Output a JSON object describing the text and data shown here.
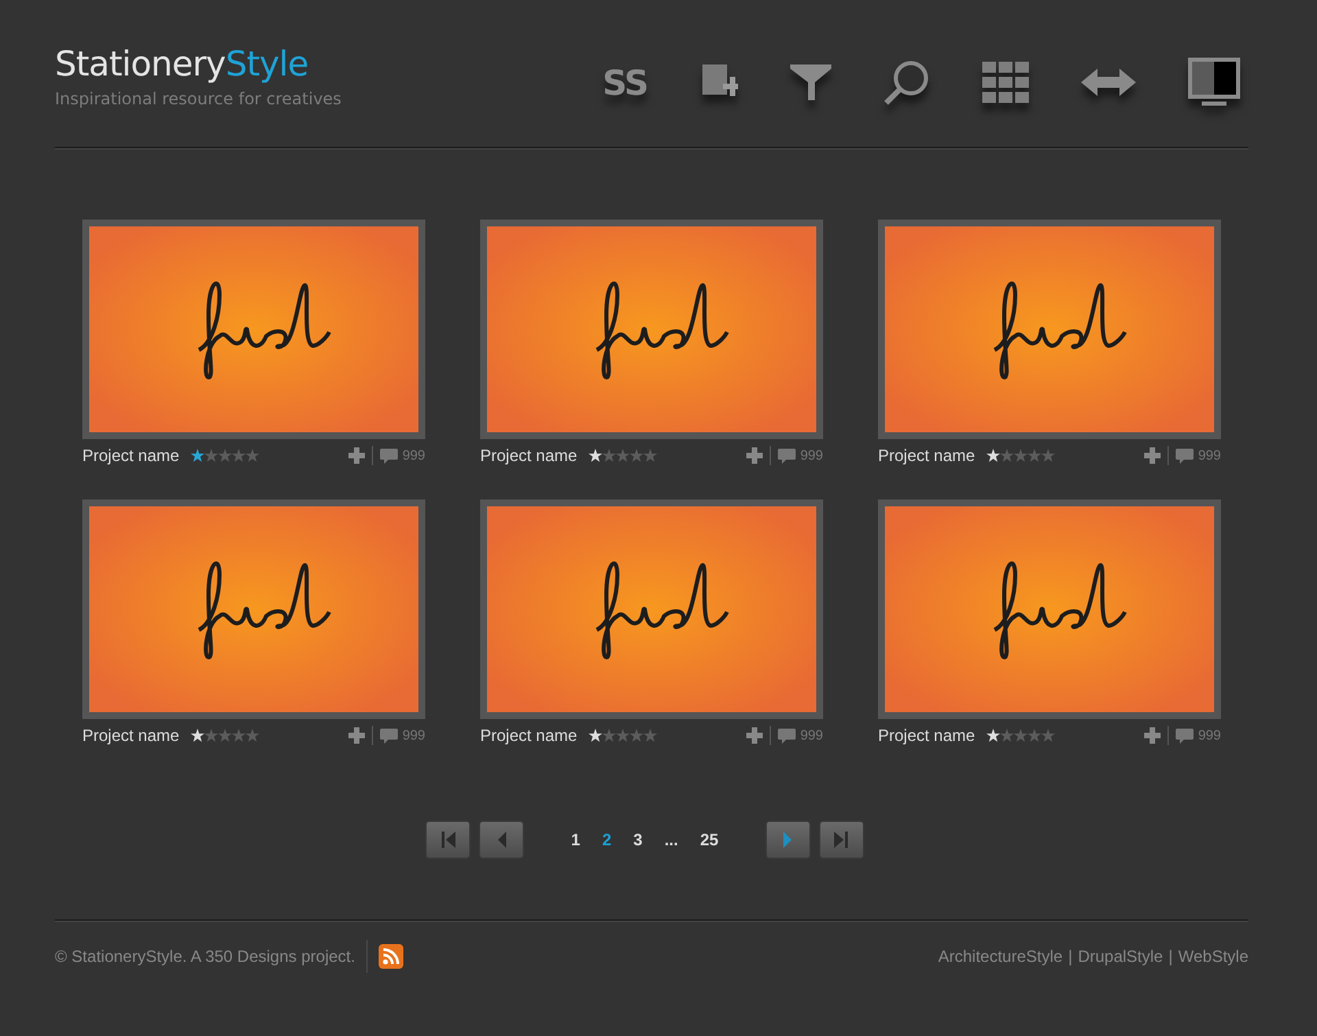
{
  "header": {
    "logo_main": "Stationery",
    "logo_accent": "Style",
    "tagline": "Inspirational resource for creatives",
    "toolbar": [
      {
        "kind": "text",
        "label": "SS"
      },
      {
        "kind": "add"
      },
      {
        "kind": "filter"
      },
      {
        "kind": "search"
      },
      {
        "kind": "grid"
      },
      {
        "kind": "resize"
      },
      {
        "kind": "monitor"
      }
    ]
  },
  "projects": [
    {
      "name": "Project name",
      "stars": 1,
      "highlighted": true,
      "comments": "999"
    },
    {
      "name": "Project name",
      "stars": 1,
      "highlighted": false,
      "comments": "999"
    },
    {
      "name": "Project name",
      "stars": 1,
      "highlighted": false,
      "comments": "999"
    },
    {
      "name": "Project name",
      "stars": 1,
      "highlighted": false,
      "comments": "999"
    },
    {
      "name": "Project name",
      "stars": 1,
      "highlighted": false,
      "comments": "999"
    },
    {
      "name": "Project name",
      "stars": 1,
      "highlighted": false,
      "comments": "999"
    }
  ],
  "pager": {
    "before": [
      {
        "kind": "first",
        "highlighted": false
      },
      {
        "kind": "prev",
        "highlighted": false
      }
    ],
    "pages": [
      {
        "label": "1",
        "selected": false
      },
      {
        "label": "2",
        "selected": true
      },
      {
        "label": "3",
        "selected": false
      },
      {
        "label": "...",
        "selected": false
      },
      {
        "label": "25",
        "selected": false
      }
    ],
    "after": [
      {
        "kind": "next",
        "highlighted": true
      },
      {
        "kind": "last",
        "highlighted": false
      }
    ]
  },
  "footer": {
    "copyright": "© StationeryStyle. A 350 Designs project.",
    "links": [
      "ArchitectureStyle",
      "DrupalStyle",
      "WebStyle"
    ],
    "separators": [
      "|",
      "|"
    ]
  }
}
